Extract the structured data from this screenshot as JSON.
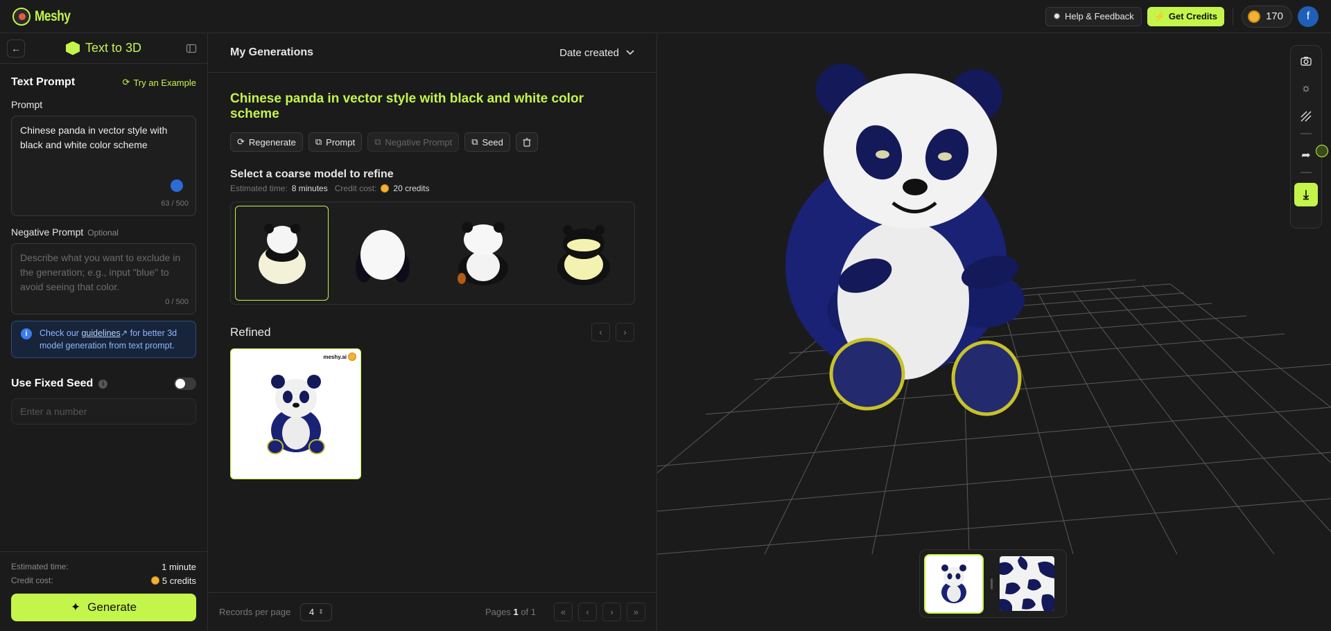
{
  "topbar": {
    "logo_text": "Meshy",
    "help_label": "Help & Feedback",
    "get_credits_label": "Get Credits",
    "credits_balance": "170",
    "avatar_initial": "f"
  },
  "left": {
    "panel_title": "Text to 3D",
    "text_prompt_heading": "Text Prompt",
    "try_example_label": "Try an Example",
    "prompt_label": "Prompt",
    "prompt_value": "Chinese panda in vector style with black and white color scheme",
    "prompt_counter": "63 / 500",
    "negative_label": "Negative Prompt",
    "negative_optional": "Optional",
    "negative_placeholder": "Describe what you want to exclude in the generation; e.g., input \"blue\" to avoid seeing that color.",
    "negative_counter": "0 / 500",
    "info_pre": "Check our ",
    "info_link": "guidelines",
    "info_post": " for better 3d model generation from text prompt.",
    "seed_heading": "Use Fixed Seed",
    "seed_placeholder": "Enter a number",
    "est_time_label": "Estimated time:",
    "est_time_value": "1 minute",
    "credit_cost_label": "Credit cost:",
    "credit_cost_value": "5 credits",
    "generate_label": "Generate"
  },
  "middle": {
    "heading": "My Generations",
    "sort_label": "Date created",
    "generation_title": "Chinese panda in vector style with black and white color scheme",
    "actions": {
      "regenerate": "Regenerate",
      "prompt": "Prompt",
      "negative_prompt": "Negative Prompt",
      "seed": "Seed"
    },
    "coarse_heading": "Select a coarse model to refine",
    "est_time_label": "Estimated time:",
    "est_time_value": "8 minutes",
    "credit_cost_label": "Credit cost:",
    "credit_cost_value": "20 credits",
    "refined_heading": "Refined",
    "watermark": "meshy.ai",
    "records_label": "Records per page",
    "records_value": "4",
    "pages_label": "Pages",
    "page_current": "1",
    "page_of": "of 1"
  },
  "colors": {
    "accent": "#c4f54b",
    "background": "#1b1b1b",
    "info_blue": "#3b7df0"
  },
  "icons": [
    "back-arrow-icon",
    "collapse-panel-icon",
    "cube-icon",
    "refresh-icon",
    "copy-icon",
    "trash-icon",
    "camera-icon",
    "light-icon",
    "wireframe-icon",
    "share-icon",
    "download-icon",
    "gift-icon",
    "sparkle-icon",
    "chevron-down-icon"
  ]
}
